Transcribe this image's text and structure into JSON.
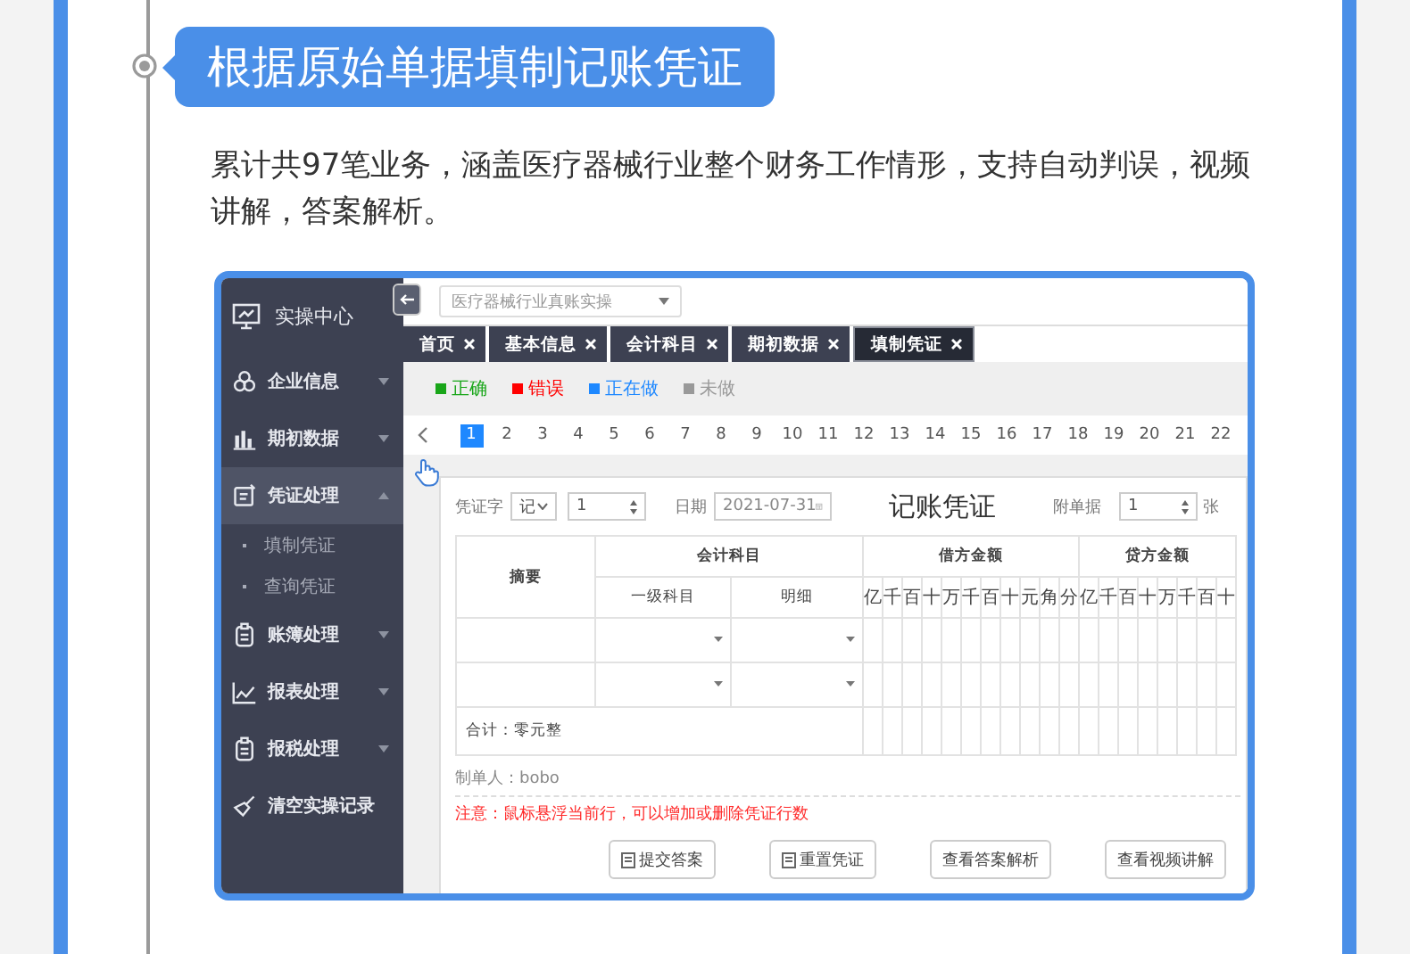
{
  "heading": "根据原始单据填制记账凭证",
  "description": "累计共97笔业务，涵盖医疗器械行业整个财务工作情形，支持自动判误，视频讲解，答案解析。",
  "app": {
    "sidebar": {
      "title": "实操中心",
      "items": [
        {
          "label": "企业信息",
          "kind": "menu",
          "expanded": false
        },
        {
          "label": "期初数据",
          "kind": "menu",
          "expanded": false
        },
        {
          "label": "凭证处理",
          "kind": "menu",
          "expanded": true,
          "children": [
            {
              "label": "填制凭证"
            },
            {
              "label": "查询凭证"
            }
          ]
        },
        {
          "label": "账簿处理",
          "kind": "menu",
          "expanded": false
        },
        {
          "label": "报表处理",
          "kind": "menu",
          "expanded": false
        },
        {
          "label": "报税处理",
          "kind": "menu",
          "expanded": false
        },
        {
          "label": "清空实操记录",
          "kind": "action"
        }
      ]
    },
    "industry_select": {
      "value": "医疗器械行业真账实操"
    },
    "tabs": [
      {
        "label": "首页",
        "selected": false
      },
      {
        "label": "基本信息",
        "selected": false
      },
      {
        "label": "会计科目",
        "selected": false
      },
      {
        "label": "期初数据",
        "selected": false
      },
      {
        "label": "填制凭证",
        "selected": true
      }
    ],
    "legend": [
      {
        "label": "正确",
        "color": "#19a619"
      },
      {
        "label": "错误",
        "color": "#ff0000"
      },
      {
        "label": "正在做",
        "color": "#1e88ff"
      },
      {
        "label": "未做",
        "color": "#999999"
      }
    ],
    "pages": [
      {
        "label": "1",
        "selected": true
      },
      {
        "label": "2",
        "selected": false
      },
      {
        "label": "3",
        "selected": false
      },
      {
        "label": "4",
        "selected": false
      },
      {
        "label": "5",
        "selected": false
      },
      {
        "label": "6",
        "selected": false
      },
      {
        "label": "7",
        "selected": false
      },
      {
        "label": "8",
        "selected": false
      },
      {
        "label": "9",
        "selected": false
      },
      {
        "label": "10",
        "selected": false
      },
      {
        "label": "11",
        "selected": false
      },
      {
        "label": "12",
        "selected": false
      },
      {
        "label": "13",
        "selected": false
      },
      {
        "label": "14",
        "selected": false
      },
      {
        "label": "15",
        "selected": false
      },
      {
        "label": "16",
        "selected": false
      },
      {
        "label": "17",
        "selected": false
      },
      {
        "label": "18",
        "selected": false
      },
      {
        "label": "19",
        "selected": false
      },
      {
        "label": "20",
        "selected": false
      },
      {
        "label": "21",
        "selected": false
      },
      {
        "label": "22",
        "selected": false
      }
    ],
    "voucher": {
      "word_label": "凭证字",
      "word_value": "记",
      "number": "1",
      "date_label": "日期",
      "date_value": "2021-07-31",
      "title": "记账凭证",
      "attachments_label": "附单据",
      "attachments_value": "1",
      "attachments_unit": "张",
      "summary_header": "摘要",
      "account_header": "会计科目",
      "account_level1_header": "一级科目",
      "account_detail_header": "明细",
      "debit_header": "借方金额",
      "credit_header": "贷方金额",
      "debit_digits": [
        "亿",
        "千",
        "百",
        "十",
        "万",
        "千",
        "百",
        "十",
        "元",
        "角",
        "分"
      ],
      "credit_digits": [
        "亿",
        "千",
        "百",
        "十",
        "万",
        "千",
        "百",
        "十"
      ],
      "total": "合计：零元整",
      "maker": "制单人：bobo",
      "note": "注意：鼠标悬浮当前行，可以增加或删除凭证行数",
      "buttons": [
        {
          "label": "提交答案",
          "kind": "icon"
        },
        {
          "label": "重置凭证",
          "kind": "icon"
        },
        {
          "label": "查看答案解析",
          "kind": "plain"
        },
        {
          "label": "查看视频讲解",
          "kind": "plain"
        }
      ]
    }
  }
}
